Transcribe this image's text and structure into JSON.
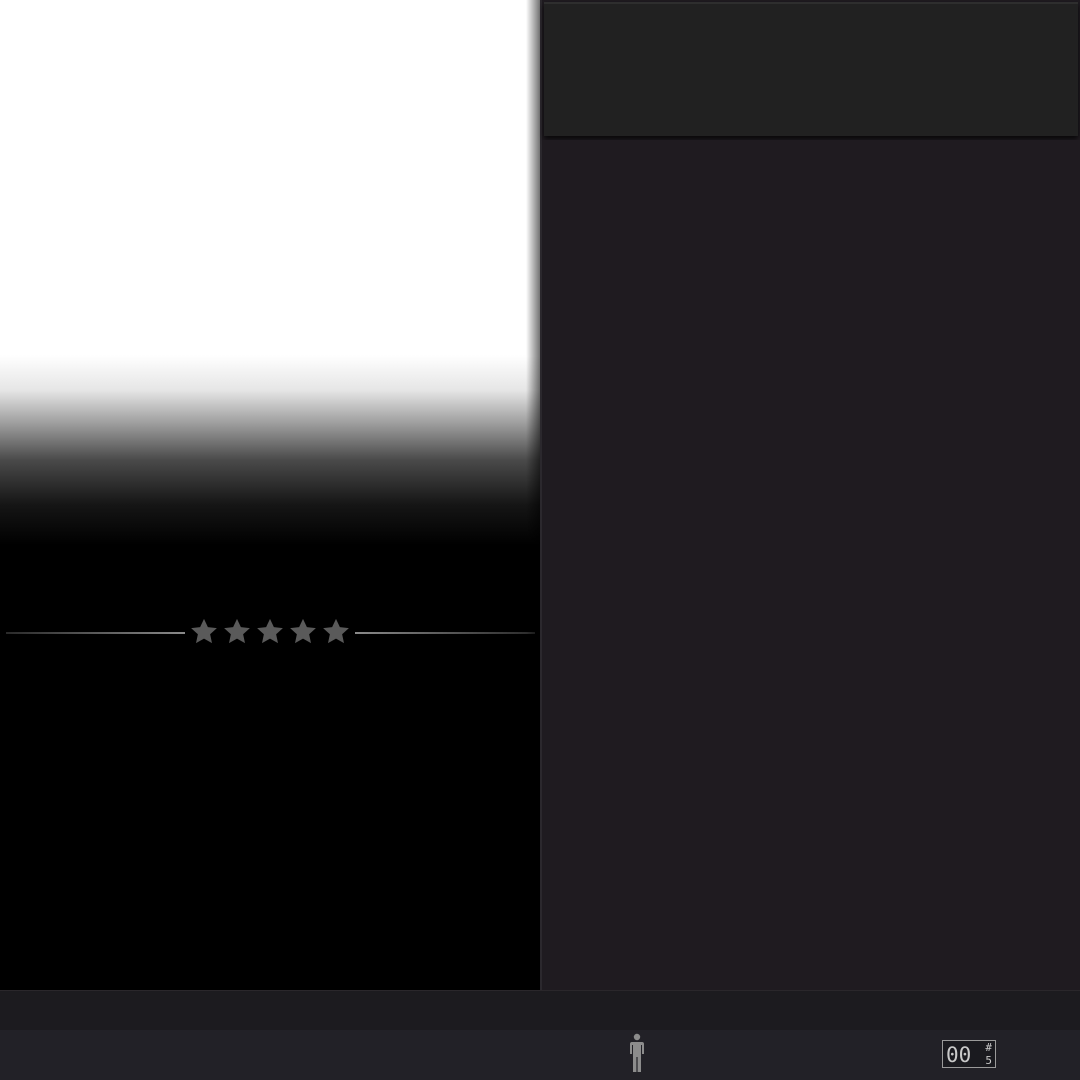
{
  "preview": {
    "rating": {
      "stars_filled": 0,
      "stars_total": 5,
      "star_color": "#5a5a5a"
    }
  },
  "status_bar": {
    "person_icon": "person-icon",
    "counter": {
      "digits": "00",
      "superscript": "#",
      "subscript": "5"
    }
  },
  "colors": {
    "panel_background": "#1f1b20",
    "header_background": "#212121",
    "bottom_bar": "#222127",
    "icon_gray": "#8c8c8c"
  }
}
